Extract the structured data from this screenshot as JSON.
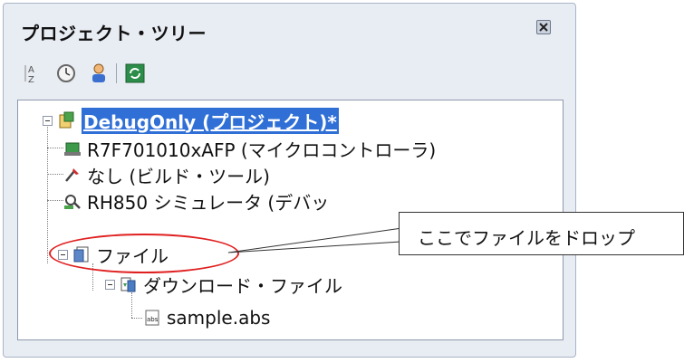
{
  "panel": {
    "title": "プロジェクト・ツリー"
  },
  "toolbar": {
    "buttons": [
      {
        "icon": "sort-icon"
      },
      {
        "icon": "clock-icon"
      },
      {
        "icon": "person-icon"
      },
      {
        "icon": "refresh-icon"
      }
    ]
  },
  "tree": {
    "items": [
      {
        "label": "DebugOnly (プロジェクト)*",
        "icon": "project-icon",
        "selected": true
      },
      {
        "label": "R7F701010xAFP (マイクロコントローラ)",
        "icon": "microcontroller-icon"
      },
      {
        "label": "なし (ビルド・ツール)",
        "icon": "build-tool-icon"
      },
      {
        "label": "RH850 シミュレータ (デバッ",
        "icon": "debug-tool-icon"
      },
      {
        "label": "ファイル",
        "icon": "folder-icon"
      },
      {
        "label": "ダウンロード・ファイル",
        "icon": "download-file-icon"
      },
      {
        "label": "sample.abs",
        "icon": "abs-file-icon"
      }
    ]
  },
  "callout": {
    "text": "ここでファイルをドロップ"
  },
  "colors": {
    "selection": "#2f6fd6",
    "highlight_ellipse": "#e02020",
    "panel_bg": "#e8ecf3"
  }
}
